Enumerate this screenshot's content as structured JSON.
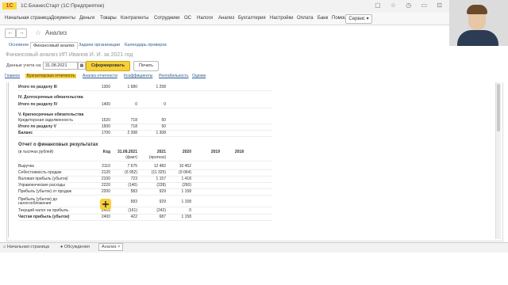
{
  "app": {
    "logo": "1С",
    "title": "1С:БизнесСтарт  (1С:Предприятие)"
  },
  "menu": [
    "Начальная страница",
    "Документы",
    "Деньги",
    "Товары",
    "Контрагенты",
    "Сотрудники",
    "ОС",
    "Налоги",
    "Анализ",
    "Бухгалтерия",
    "Настройки",
    "Оплата",
    "Банк",
    "Помощь"
  ],
  "service_button": "Сервис ▾",
  "nav": {
    "back": "←",
    "forward": "→",
    "star": "☆",
    "title": "Анализ"
  },
  "tabs": [
    "Основное",
    "Финансовый анализ",
    "Задачи организации",
    "Календарь проверок"
  ],
  "report_title": "Финансовый анализ ИП Иванов И. И. за 2021 год",
  "filter": {
    "label": "Данные учета на:",
    "date": "31.08.2021",
    "cal": "▦",
    "generate": "Сформировать",
    "print": "Печать"
  },
  "subtabs": [
    "Главное",
    "Бухгалтерская отчетность",
    "Анализ отчетности",
    "Коэффициенты",
    "Рентабельность",
    "Оценки"
  ],
  "balance": {
    "row_itogo3": {
      "n": "Итого по разделу III",
      "c": "1300",
      "v1": "1 680",
      "v2": "1 258"
    },
    "sec4": "IV. Долгосрочные обязательства",
    "row_itogo4": {
      "n": "Итого по разделу IV",
      "c": "1400",
      "v1": "0",
      "v2": "0"
    },
    "sec5": "V. Краткосрочные обязательства",
    "row_kred": {
      "n": "Кредиторская задолженность",
      "c": "1520",
      "v1": "718",
      "v2": "50"
    },
    "row_itogo5": {
      "n": "Итого по разделу V",
      "c": "1500",
      "v1": "718",
      "v2": "50"
    },
    "row_balance": {
      "n": "Баланс",
      "c": "1700",
      "v1": "2 398",
      "v2": "1 308"
    }
  },
  "pl": {
    "title": "Отчет о финансовых результатах",
    "units": "(в тысячах рублей)",
    "head": {
      "code": "Код",
      "c1": "31.08.2021",
      "c1sub": "(факт)",
      "c2": "2021",
      "c2sub": "(прогноз)",
      "c3": "2020",
      "c4": "2019",
      "c5": "2018"
    },
    "rows": [
      {
        "n": "Выручка",
        "c": "2110",
        "v1": "7 675",
        "v2": "12 482",
        "v3": "10 452"
      },
      {
        "n": "Себестоимость продаж",
        "c": "2120",
        "v1": "(6 952)",
        "v2": "(11 325)",
        "v3": "(9 064)"
      },
      {
        "n": "Валовая прибыль (убыток)",
        "c": "2100",
        "v1": "723",
        "v2": "1 157",
        "v3": "1 418"
      },
      {
        "n": "Управленческие расходы",
        "c": "2220",
        "v1": "(140)",
        "v2": "(228)",
        "v3": "(260)"
      },
      {
        "n": "Прибыль (убыток) от продаж",
        "c": "2200",
        "v1": "583",
        "v2": "929",
        "v3": "1 158"
      },
      {
        "n": "Прибыль (убыток) до",
        "n2": "налогообложения",
        "c": "2300",
        "v1": "583",
        "v2": "929",
        "v3": "1 158"
      },
      {
        "n": "Текущий налог на прибыль",
        "c": "2410",
        "v1": "(161)",
        "v2": "(242)",
        "v3": "0"
      },
      {
        "n": "Чистая прибыль (убыток)",
        "c": "2400",
        "v1": "422",
        "v2": "687",
        "v3": "1 158"
      }
    ]
  },
  "bottom_tabs": [
    "Начальная страница",
    "Обсуждения",
    "Анализ"
  ],
  "bottom_close": "×"
}
